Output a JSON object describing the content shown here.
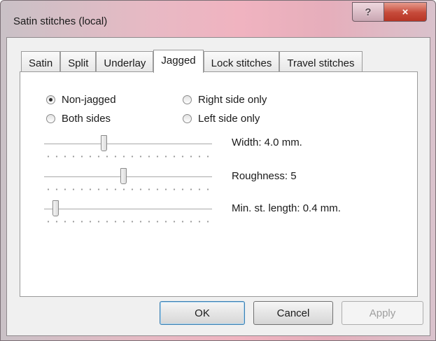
{
  "window": {
    "title": "Satin stitches (local)",
    "help_glyph": "?",
    "close_glyph": "×"
  },
  "tabs": [
    {
      "label": "Satin",
      "active": false
    },
    {
      "label": "Split",
      "active": false
    },
    {
      "label": "Underlay",
      "active": false
    },
    {
      "label": "Jagged",
      "active": true
    },
    {
      "label": "Lock stitches",
      "active": false
    },
    {
      "label": "Travel stitches",
      "active": false
    }
  ],
  "jagged": {
    "radios": [
      {
        "label": "Non-jagged",
        "checked": true
      },
      {
        "label": "Right side only",
        "checked": false
      },
      {
        "label": "Both sides",
        "checked": false
      },
      {
        "label": "Left side only",
        "checked": false
      }
    ],
    "sliders": [
      {
        "label": "Width:  4.0 mm.",
        "value_fraction": 0.35
      },
      {
        "label": "Roughness: 5",
        "value_fraction": 0.47
      },
      {
        "label": "Min. st. length:  0.4 mm.",
        "value_fraction": 0.05
      }
    ]
  },
  "buttons": {
    "ok": "OK",
    "cancel": "Cancel",
    "apply": "Apply"
  },
  "colors": {
    "title_bar": "#e8b9c4",
    "close_button": "#c64a3a",
    "default_button_border": "#3c7fb1"
  }
}
